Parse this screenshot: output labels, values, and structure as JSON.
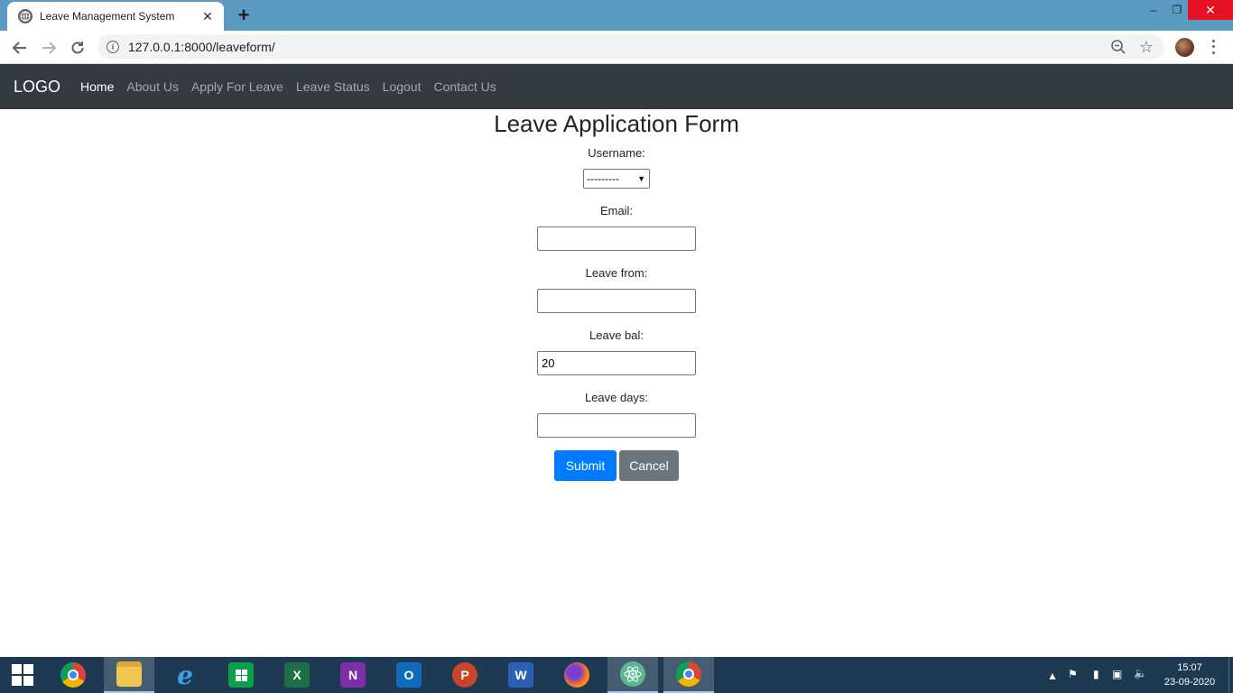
{
  "browser": {
    "tab_title": "Leave Management System",
    "new_tab": "+",
    "url": "127.0.0.1:8000/leaveform/",
    "window": {
      "minimize": "–",
      "restore": "❐",
      "close": "✕"
    }
  },
  "navbar": {
    "brand": "LOGO",
    "links": [
      "Home",
      "About Us",
      "Apply For Leave",
      "Leave Status",
      "Logout",
      "Contact Us"
    ],
    "active_link": "Home"
  },
  "form": {
    "title": "Leave Application Form",
    "username_label": "Username:",
    "username_value": "---------",
    "email_label": "Email:",
    "email_value": "",
    "leave_from_label": "Leave from:",
    "leave_from_value": "",
    "leave_bal_label": "Leave bal:",
    "leave_bal_value": "20",
    "leave_days_label": "Leave days:",
    "leave_days_value": "",
    "submit_label": "Submit",
    "cancel_label": "Cancel"
  },
  "taskbar": {
    "apps": [
      "start",
      "chrome",
      "file-explorer",
      "internet-explorer",
      "store",
      "excel",
      "onenote",
      "outlook",
      "powerpoint",
      "word",
      "firefox",
      "atom",
      "chrome-profile"
    ],
    "time": "15:07",
    "date": "23-09-2020"
  },
  "colors": {
    "tabstrip": "#5b9ac1",
    "navbar": "#343a40",
    "primary": "#007bff",
    "secondary": "#6c757d",
    "taskbar": "#1e3a52"
  }
}
